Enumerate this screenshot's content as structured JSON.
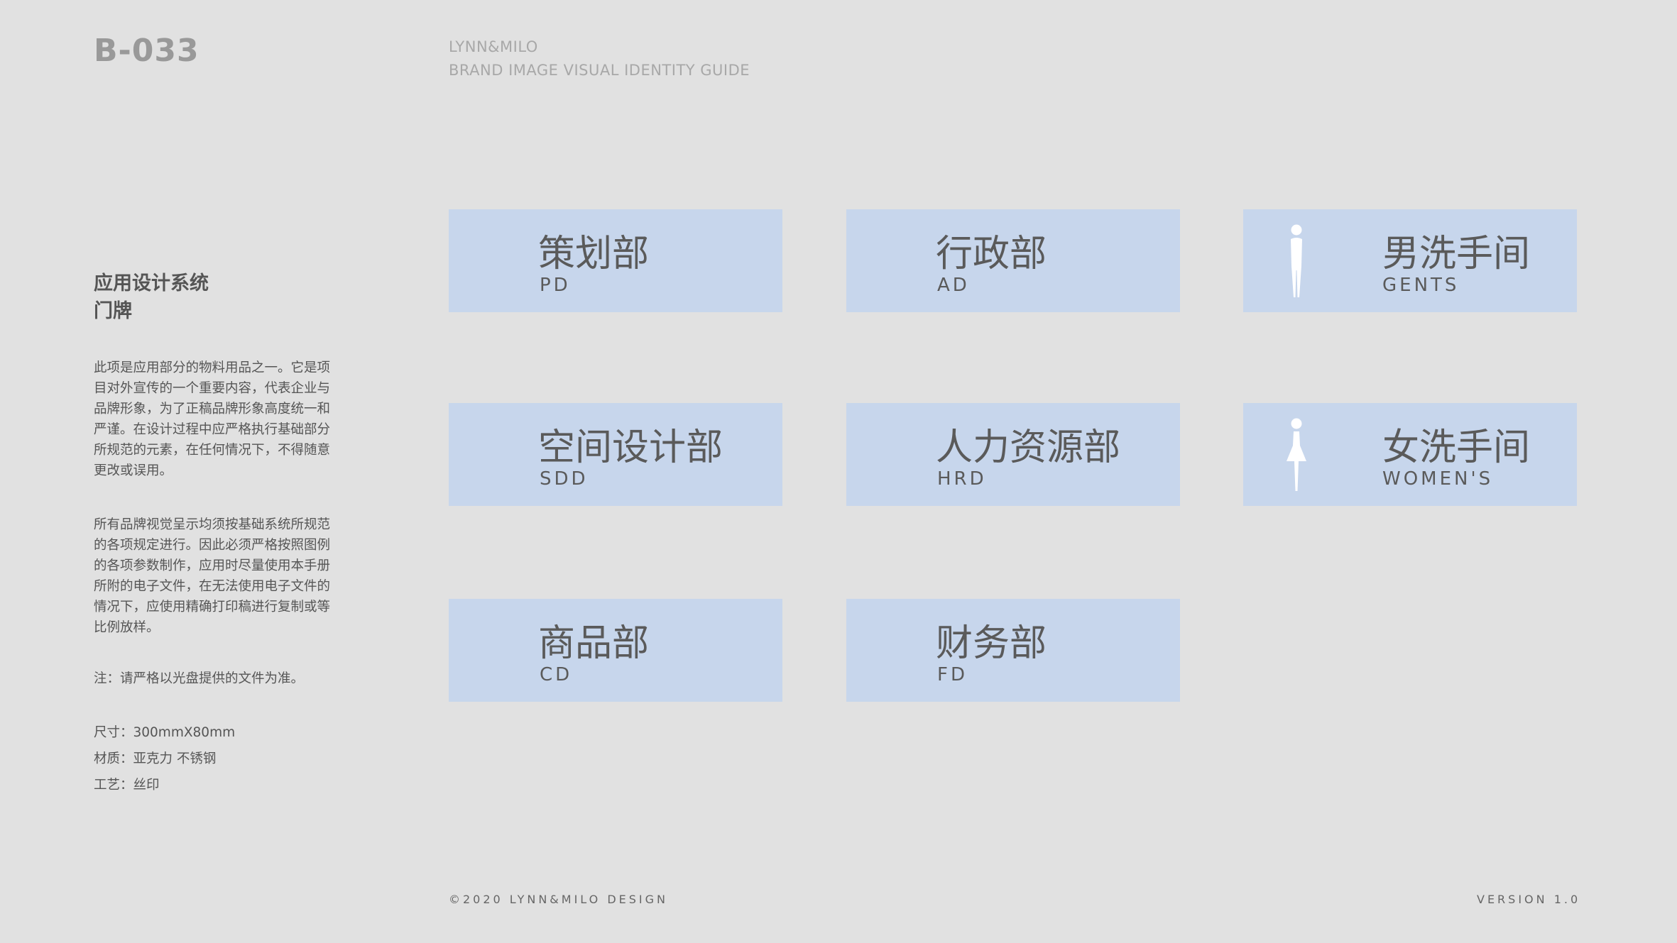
{
  "header": {
    "page_code": "B-033",
    "brand_name": "LYNN&MILO",
    "guide_title": "BRAND IMAGE VISUAL IDENTITY GUIDE"
  },
  "sidebar": {
    "title_line1": "应用设计系统",
    "title_line2": "门牌",
    "paragraph1": "此项是应用部分的物料用品之一。它是项目对外宣传的一个重要内容，代表企业与品牌形象，为了正稿品牌形象高度统一和严谨。在设计过程中应严格执行基础部分所规范的元素，在任何情况下，不得随意更改或误用。",
    "paragraph2": "所有品牌视觉呈示均须按基础系统所规范的各项规定进行。因此必须严格按照图例的各项参数制作，应用时尽量使用本手册所附的电子文件，在无法使用电子文件的情况下，应使用精确打印稿进行复制或等比例放样。",
    "note": "注：请严格以光盘提供的文件为准。",
    "spec_size": "尺寸：300mmX80mm",
    "spec_material": "材质：亚克力  不锈钢",
    "spec_process": "工艺：丝印"
  },
  "signs": [
    {
      "cn": "策划部",
      "en": "PD"
    },
    {
      "cn": "行政部",
      "en": "AD"
    },
    {
      "cn": "男洗手间",
      "en": "GENTS",
      "icon": "man-icon"
    },
    {
      "cn": "空间设计部",
      "en": "SDD"
    },
    {
      "cn": "人力资源部",
      "en": "HRD"
    },
    {
      "cn": "女洗手间",
      "en": "WOMEN'S",
      "icon": "woman-icon"
    },
    {
      "cn": "商品部",
      "en": "CD"
    },
    {
      "cn": "财务部",
      "en": "FD"
    }
  ],
  "colors": {
    "sign_background": "#c7d6ec",
    "page_background": "#e1e1e1"
  },
  "footer": {
    "copyright": "©2020 LYNN&MILO DESIGN",
    "version": "VERSION 1.0"
  }
}
